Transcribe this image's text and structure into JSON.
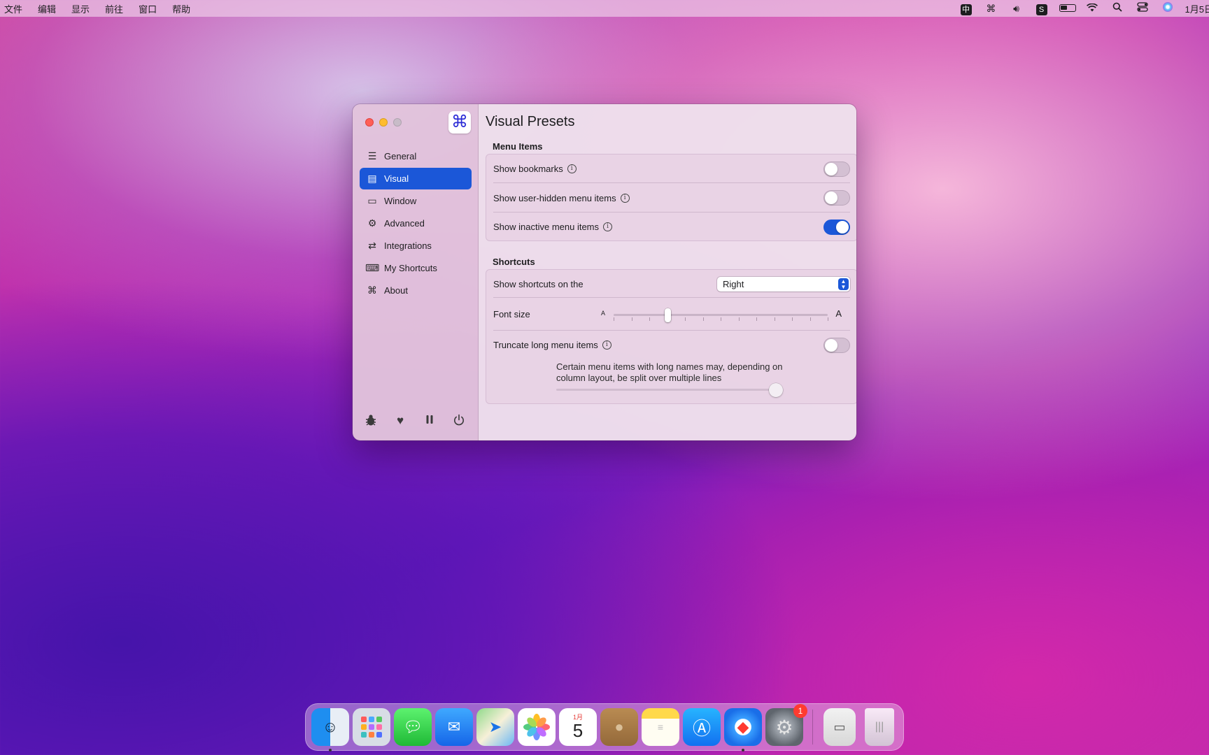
{
  "menubar": {
    "menus": [
      "文件",
      "编辑",
      "显示",
      "前往",
      "窗口",
      "帮助"
    ],
    "status_icons": [
      "input-method-icon",
      "command-icon",
      "volume-icon",
      "sync-icon",
      "battery-icon",
      "wifi-icon",
      "spotlight-icon",
      "control-center-icon",
      "siri-icon"
    ],
    "input_method_label": "中",
    "clock": "1月5日"
  },
  "window": {
    "title": "Visual Presets",
    "sidebar": {
      "items": [
        {
          "label": "General",
          "icon": "general-list-icon",
          "active": false
        },
        {
          "label": "Visual",
          "icon": "visual-icon",
          "active": true
        },
        {
          "label": "Window",
          "icon": "window-icon",
          "active": false
        },
        {
          "label": "Advanced",
          "icon": "gears-icon",
          "active": false
        },
        {
          "label": "Integrations",
          "icon": "integrations-icon",
          "active": false
        },
        {
          "label": "My Shortcuts",
          "icon": "keyboard-icon",
          "active": false
        },
        {
          "label": "About",
          "icon": "command-icon",
          "active": false
        }
      ],
      "footer_icons": [
        "bug-icon",
        "heart-icon",
        "pause-icon",
        "power-icon"
      ]
    },
    "menu_items_section": {
      "label": "Menu Items",
      "rows": [
        {
          "label": "Show bookmarks",
          "on": false
        },
        {
          "label": "Show user-hidden menu items",
          "on": false
        },
        {
          "label": "Show inactive menu items",
          "on": true
        }
      ]
    },
    "shortcuts_section": {
      "label": "Shortcuts",
      "position_label": "Show shortcuts on the",
      "position_value": "Right",
      "font_size_label": "Font size",
      "font_size_min_glyph": "A",
      "font_size_max_glyph": "A",
      "font_size_level": 0.25,
      "truncate_label": "Truncate long menu items",
      "truncate_on": false,
      "truncate_note": "Certain menu items with long names may, depending on column layout, be split over multiple lines",
      "truncate_slider_level": 1.0
    }
  },
  "dock": {
    "apps": [
      "Finder",
      "Launchpad",
      "Messages",
      "Mail",
      "Maps",
      "Photos",
      "Calendar",
      "Contacts",
      "Notes",
      "App Store",
      "Safari",
      "System Preferences",
      "Downloads",
      "Trash"
    ],
    "calendar_month": "1月",
    "calendar_day": "5",
    "settings_badge": "1"
  },
  "colors": {
    "accent": "#1b57d8",
    "close": "#ff5f57",
    "minimize": "#febc2e",
    "badge": "#ff3b30"
  }
}
